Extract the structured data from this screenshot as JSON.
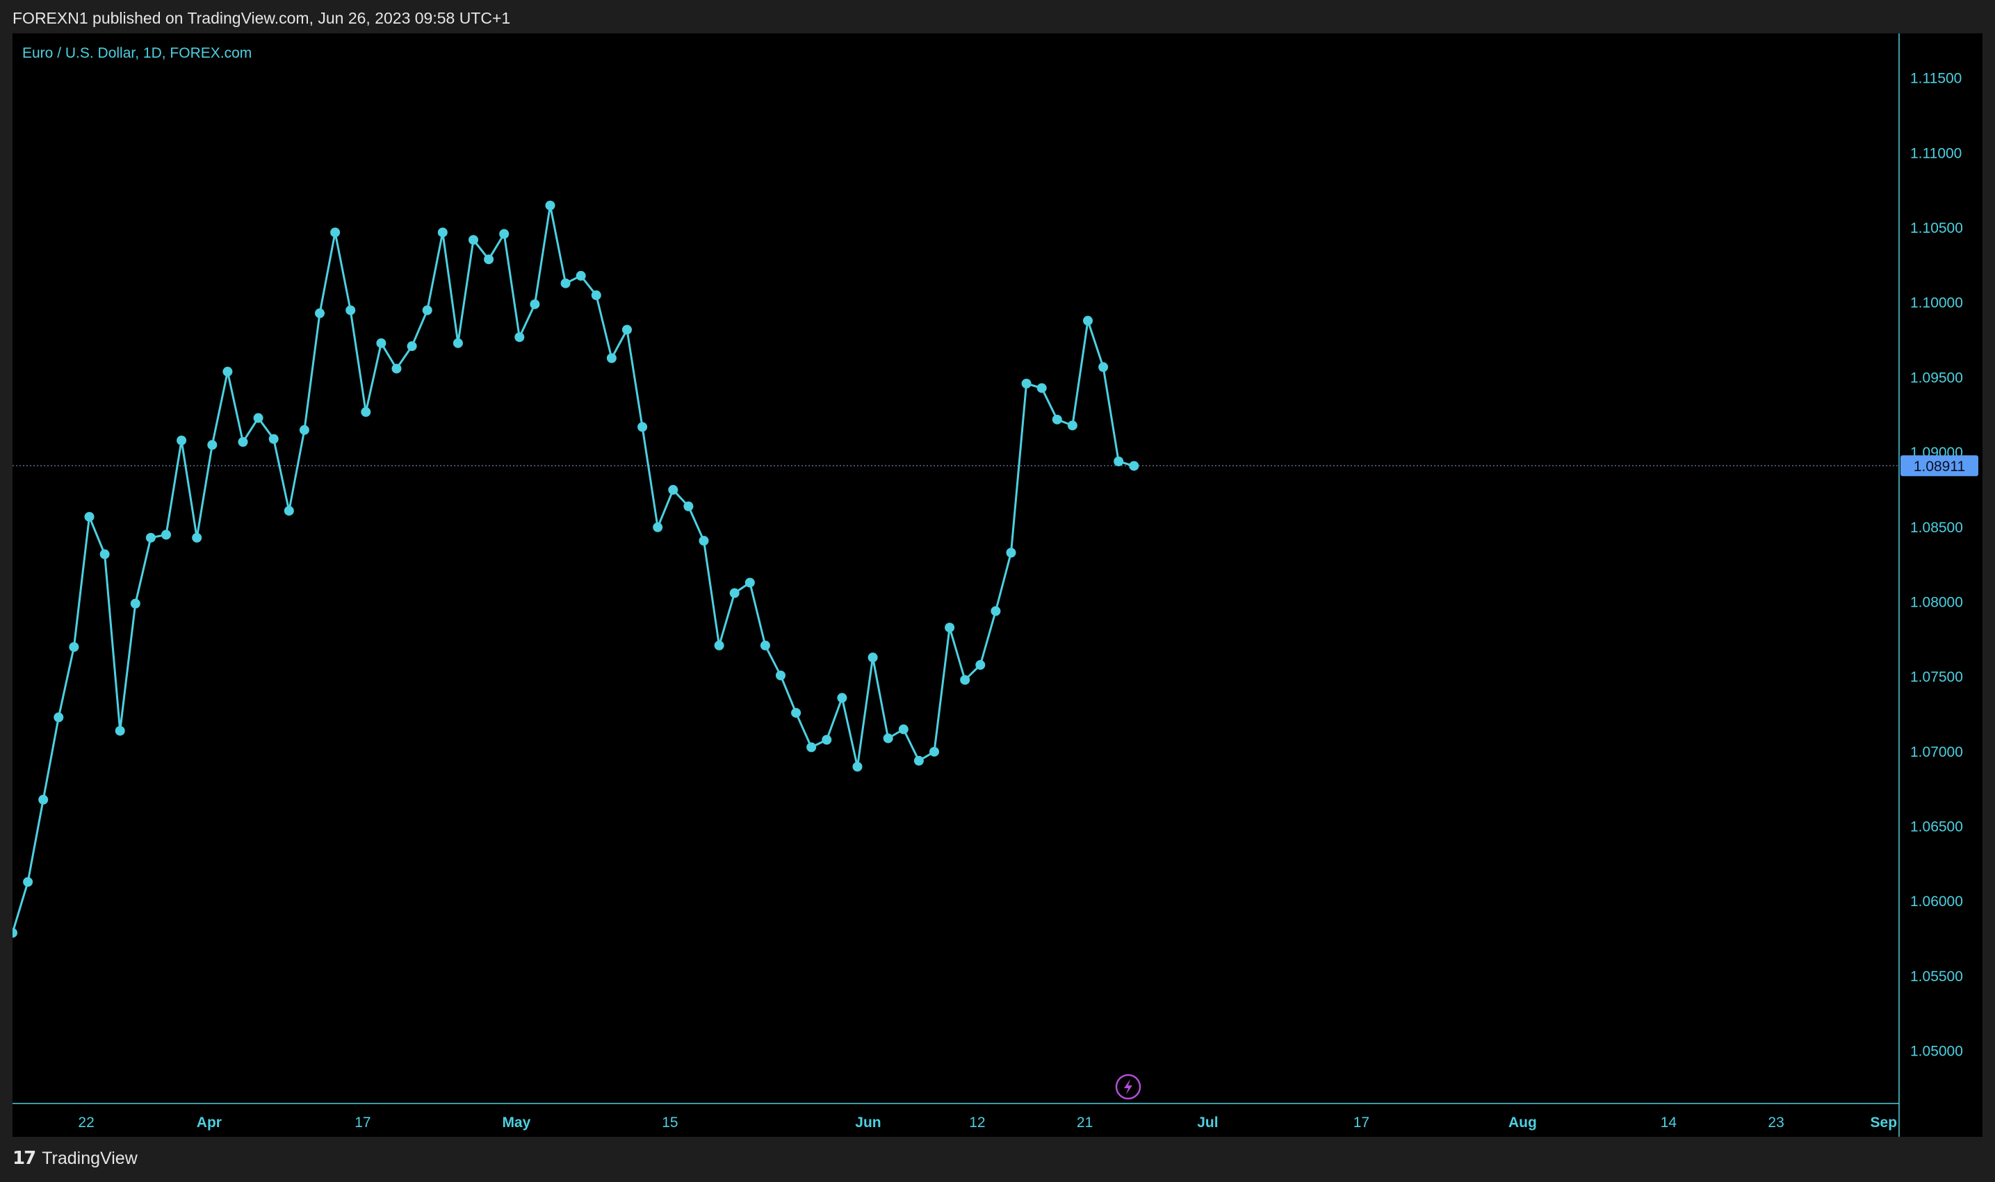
{
  "header": {
    "published": "FOREXN1 published on TradingView.com, Jun 26, 2023 09:58 UTC+1"
  },
  "footer": {
    "brand": "TradingView",
    "logo_icon": "tradingview-logo-icon"
  },
  "colors": {
    "line": "#4dd0e1",
    "axis_text": "#4dd0e1",
    "axis_line": "#4dd0e1",
    "price_label_bg": "#5b9cf6",
    "price_label_text": "#0b1020",
    "lightning": "#b24fd6",
    "background": "#000000"
  },
  "chart_data": {
    "type": "line",
    "title": "Euro / U.S. Dollar, 1D, FOREX.com",
    "ylim": [
      1.0465,
      1.118
    ],
    "yticks": [
      "1.11500",
      "1.11000",
      "1.10500",
      "1.10000",
      "1.09500",
      "1.09000",
      "1.08500",
      "1.08000",
      "1.07500",
      "1.07000",
      "1.06500",
      "1.06000",
      "1.05500",
      "1.05000"
    ],
    "last_price": 1.08911,
    "last_price_label": "1.08911",
    "xticks": [
      {
        "label": "22",
        "index": 4.8,
        "bold": false
      },
      {
        "label": "Apr",
        "index": 12.8,
        "bold": true
      },
      {
        "label": "17",
        "index": 22.8,
        "bold": false
      },
      {
        "label": "May",
        "index": 32.8,
        "bold": true
      },
      {
        "label": "15",
        "index": 42.8,
        "bold": false
      },
      {
        "label": "Jun",
        "index": 55.7,
        "bold": true
      },
      {
        "label": "12",
        "index": 62.8,
        "bold": false
      },
      {
        "label": "21",
        "index": 69.8,
        "bold": false
      },
      {
        "label": "Jul",
        "index": 77.8,
        "bold": true
      },
      {
        "label": "17",
        "index": 87.8,
        "bold": false
      },
      {
        "label": "Aug",
        "index": 98.3,
        "bold": true
      },
      {
        "label": "14",
        "index": 107.8,
        "bold": false
      },
      {
        "label": "23",
        "index": 114.8,
        "bold": false
      },
      {
        "label": "Sep",
        "index": 121.8,
        "bold": true
      }
    ],
    "series": [
      {
        "values": [
          1.0579,
          1.0613,
          1.0668,
          1.0723,
          1.077,
          1.0857,
          1.0832,
          1.0714,
          1.0799,
          1.0843,
          1.0845,
          1.0908,
          1.0843,
          1.0905,
          1.0954,
          1.0907,
          1.0923,
          1.0909,
          1.0861,
          1.0915,
          1.0993,
          1.1047,
          1.0995,
          1.0927,
          1.0973,
          1.0956,
          1.0971,
          1.0995,
          1.1047,
          1.0973,
          1.1042,
          1.1029,
          1.1046,
          1.0977,
          1.0999,
          1.1065,
          1.1013,
          1.1018,
          1.1005,
          1.0963,
          1.0982,
          1.0917,
          1.085,
          1.0875,
          1.0864,
          1.0841,
          1.0771,
          1.0806,
          1.0813,
          1.0771,
          1.0751,
          1.0726,
          1.0703,
          1.0708,
          1.0736,
          1.069,
          1.0763,
          1.0709,
          1.0715,
          1.0694,
          1.07,
          1.0783,
          1.0748,
          1.0758,
          1.0794,
          1.0833,
          1.0946,
          1.0943,
          1.0922,
          1.0918,
          1.0988,
          1.0957,
          1.0894,
          1.0891
        ]
      }
    ]
  }
}
